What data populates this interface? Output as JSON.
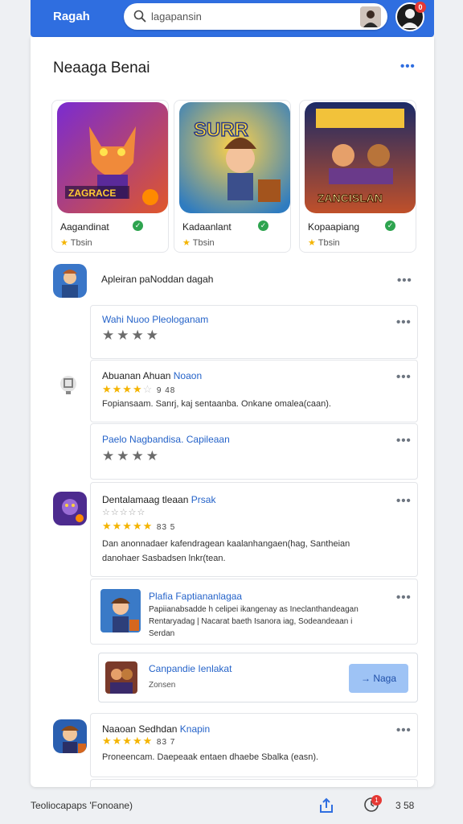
{
  "header": {
    "brand": "Ragah",
    "search_value": "lagapansin",
    "profile_badge": "0"
  },
  "panel": {
    "title": "Neaaga Benai"
  },
  "featured": [
    {
      "name": "Aagandinat",
      "rating": "Tbsin",
      "art_label": "ZAGRACE"
    },
    {
      "name": "Kadaanlant",
      "rating": "Tbsin",
      "art_label": "SURR"
    },
    {
      "name": "Kopaapiang",
      "rating": "Tbsin",
      "art_label": "ZANCISLAN"
    }
  ],
  "rows": {
    "r1_title": "Apleiran paNoddan dagah",
    "r1a_title": "Wahi Nuoo Pleologanam",
    "r1b_title_dark": "Abuanan Ahuan",
    "r1b_title_blue": "Noaon",
    "r1b_rating_text": "9 48",
    "r1b_review": "Fopiansaam. Sanrj, kaj sentaanba. Onkane omalea(caan).",
    "r1c_title": "Paelo Nagbandisa. Capileaan",
    "r2_title_dark": "Dentalamaag tleaan",
    "r2_title_blue": "Prsak",
    "r2_rating_text": "83 5",
    "r2_review_l1": "Dan anonnadaer kafendragean kaalanhangaen(hag, Santheian",
    "r2_review_l2": "danohaer Sasbadsen lnkr(tean.",
    "r2a_title": "Plafia Faptiananlagaa",
    "r2a_l1": "Papiianabsadde h celipei ikangenay as Ineclanthandeagan",
    "r2a_l2": "Rentaryadag | Nacarat baeth Isanora iag, Sodeandeaan i",
    "r2a_l3": "Serdan",
    "r2b_title": "Canpandie Ienlakat",
    "r2b_sub": "Zonsen",
    "r2b_button": "Naga",
    "r3_title_dark": "Naaoan Sedhdan",
    "r3_title_blue": "Knapin",
    "r3_rating_text": "83 7",
    "r3_review": "Proneencam. Daepeaak entaen dhaebe Sbalka (easn)."
  },
  "bottom": {
    "text": "Teoliocapaps 'Fonoane)",
    "badge": "1",
    "count": "3 58"
  },
  "colors": {
    "accent": "#2f6ee0",
    "star": "#f4b400",
    "verified": "#2ea44f",
    "badge": "#e53935"
  }
}
